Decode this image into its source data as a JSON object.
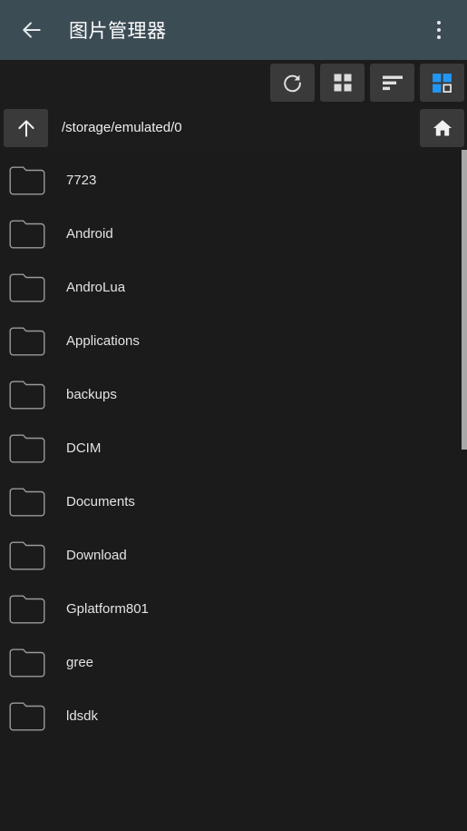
{
  "titlebar": {
    "back_icon": "arrow-left-icon",
    "title": "图片管理器",
    "overflow_icon": "overflow-menu-icon",
    "background_color": "#3c4c54"
  },
  "toolbar": {
    "background_color": "#1c1c1c",
    "button_color": "#3a3a3a",
    "buttons": [
      {
        "name": "refresh-button",
        "icon": "refresh-icon",
        "label": "Refresh"
      },
      {
        "name": "grid-view-button",
        "icon": "grid-view-icon",
        "label": "Grid view"
      },
      {
        "name": "sort-button",
        "icon": "sort-icon",
        "label": "Sort"
      },
      {
        "name": "select-mode-button",
        "icon": "multi-select-icon",
        "label": "Select",
        "accent_color": "#2196f3"
      }
    ]
  },
  "pathbar": {
    "up_icon": "arrow-up-icon",
    "path": "/storage/emulated/0",
    "home_icon": "home-icon"
  },
  "file_list": {
    "items": [
      {
        "name": "7723",
        "type": "folder"
      },
      {
        "name": "Android",
        "type": "folder"
      },
      {
        "name": "AndroLua",
        "type": "folder"
      },
      {
        "name": "Applications",
        "type": "folder"
      },
      {
        "name": "backups",
        "type": "folder"
      },
      {
        "name": "DCIM",
        "type": "folder"
      },
      {
        "name": "Documents",
        "type": "folder"
      },
      {
        "name": "Download",
        "type": "folder"
      },
      {
        "name": "Gplatform801",
        "type": "folder"
      },
      {
        "name": "gree",
        "type": "folder"
      },
      {
        "name": "ldsdk",
        "type": "folder"
      }
    ]
  },
  "scrollbar": {
    "color": "#a8a8a8",
    "visible": true
  }
}
